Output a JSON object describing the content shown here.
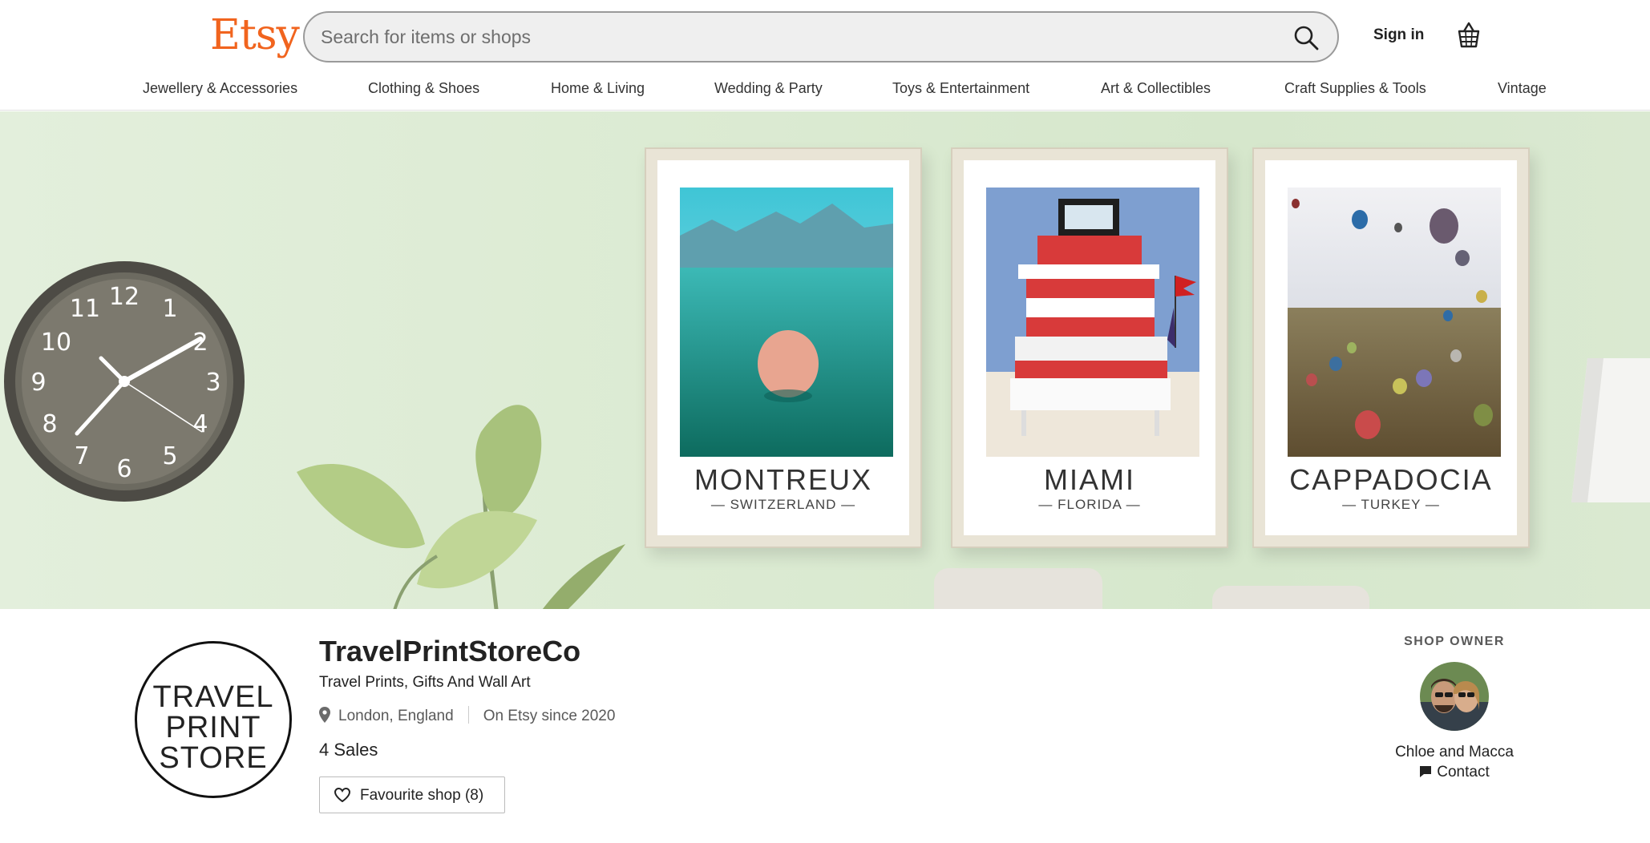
{
  "header": {
    "logo": "Etsy",
    "search_placeholder": "Search for items or shops",
    "sign_in": "Sign in"
  },
  "nav": {
    "items": [
      "Jewellery & Accessories",
      "Clothing & Shoes",
      "Home & Living",
      "Wedding & Party",
      "Toys & Entertainment",
      "Art & Collectibles",
      "Craft Supplies & Tools",
      "Vintage"
    ]
  },
  "banner": {
    "prints": [
      {
        "city": "MONTREUX",
        "country": "— SWITZERLAND —"
      },
      {
        "city": "MIAMI",
        "country": "— FLORIDA —"
      },
      {
        "city": "CAPPADOCIA",
        "country": "— TURKEY —"
      }
    ],
    "clock_numbers": [
      "12",
      "1",
      "2",
      "3",
      "4",
      "5",
      "6",
      "7",
      "8",
      "9",
      "10",
      "11"
    ]
  },
  "shop": {
    "logo_lines": [
      "TRAVEL",
      "PRINT",
      "STORE"
    ],
    "name": "TravelPrintStoreCo",
    "tagline": "Travel Prints, Gifts And Wall Art",
    "location": "London, England",
    "since": "On Etsy since 2020",
    "sales": "4 Sales",
    "favourite_label": "Favourite shop (8)"
  },
  "owner": {
    "heading": "SHOP OWNER",
    "name": "Chloe and Macca",
    "contact": "Contact"
  },
  "colors": {
    "brand": "#f1641e",
    "banner_bg": "#dcebd3"
  }
}
